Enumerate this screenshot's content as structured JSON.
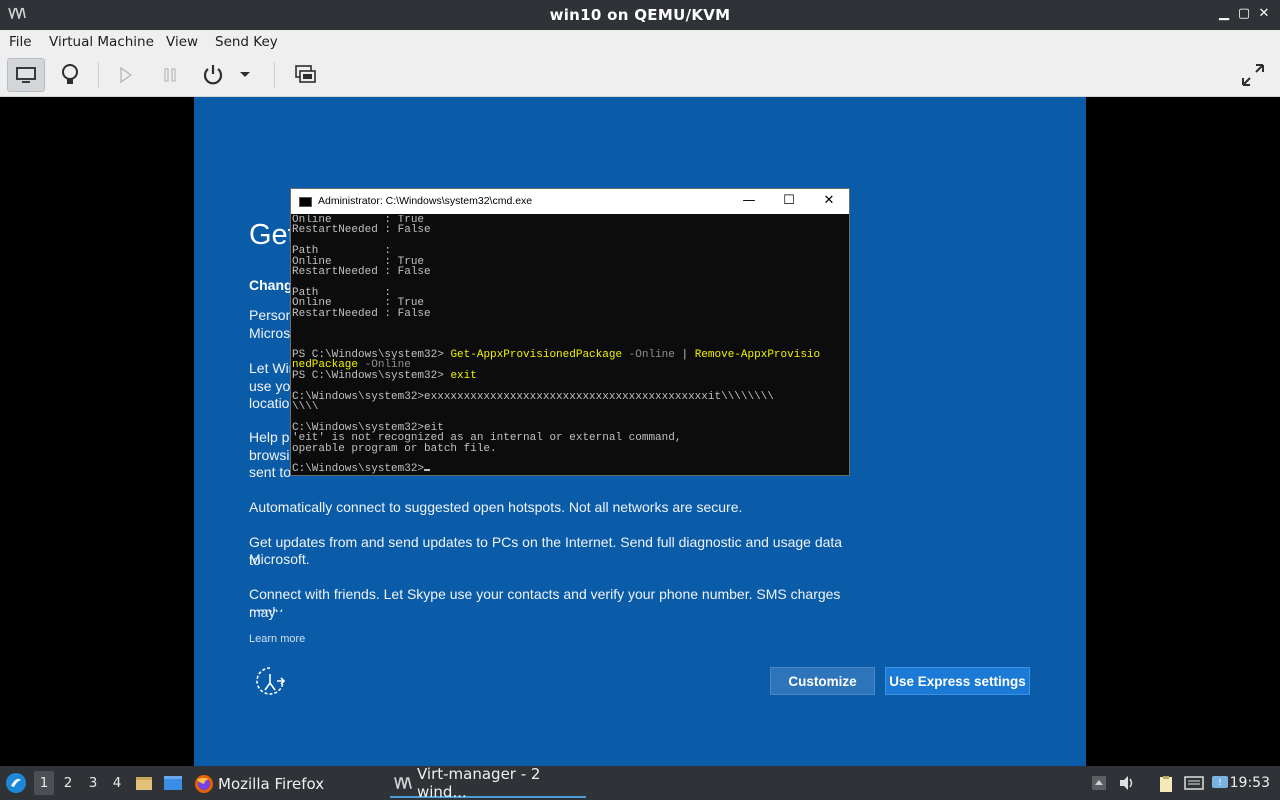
{
  "window": {
    "title": "win10 on QEMU/KVM",
    "controls": {
      "minimize": "▁",
      "maximize": "▢",
      "close": "✕"
    }
  },
  "menu": {
    "file": "File",
    "virtual_machine": "Virtual Machine",
    "view": "View",
    "send_key": "Send Key"
  },
  "toolbar": {
    "buttons": [
      "console-icon",
      "details-lightbulb-icon",
      "run-icon",
      "pause-icon",
      "power-icon",
      "power-menu-chevron-icon",
      "snapshots-icon",
      "fullscreen-icon"
    ]
  },
  "oobe": {
    "heading": "Get",
    "subheading": "Change",
    "para1_line1": "Persona",
    "para1_line2": "Microso",
    "para2_line1": "Let Win",
    "para2_line2": "use you",
    "para2_line3": "locatio",
    "para3_line1": "Help pr",
    "para3_line2": "browsin",
    "para3_line3": "sent to",
    "para_hotspots": "Automatically connect to suggested open hotspots. Not all networks are secure.",
    "para_updates_line1": "Get updates from and send updates to PCs on the Internet. Send full diagnostic and usage data to",
    "para_updates_line2": "Microsoft.",
    "para_skype_line1": "Connect with friends. Let Skype use your contacts and verify your phone number. SMS charges may",
    "para_skype_line2": "apply.",
    "learn_more": "Learn more",
    "customize": "Customize",
    "express": "Use Express settings"
  },
  "cmd": {
    "title": "Administrator: C:\\Windows\\system32\\cmd.exe",
    "controls": {
      "minimize": "—",
      "maximize": "☐",
      "close": "✕"
    },
    "lines": [
      "Online        : True",
      "RestartNeeded : False",
      "",
      "Path          :",
      "Online        : True",
      "RestartNeeded : False",
      "",
      "Path          :",
      "Online        : True",
      "RestartNeeded : False",
      "",
      "",
      "",
      "PS C:\\Windows\\system32> Get-AppxProvisionedPackage -Online | Remove-AppxProvisio",
      "nedPackage -Online",
      "PS C:\\Windows\\system32> exit",
      "",
      "C:\\Windows\\system32>exxxxxxxxxxxxxxxxxxxxxxxxxxxxxxxxxxxxxxxxxxit\\\\\\\\\\\\\\\\",
      "\\\\\\\\",
      "",
      "C:\\Windows\\system32>eit",
      "'eit' is not recognized as an internal or external command,",
      "operable program or batch file.",
      "",
      "C:\\Windows\\system32>"
    ]
  },
  "taskbar": {
    "workspaces": [
      "1",
      "2",
      "3",
      "4"
    ],
    "firefox": "Mozilla Firefox",
    "virt_manager": "Virt-manager - 2 wind...",
    "clock": "19:53"
  }
}
